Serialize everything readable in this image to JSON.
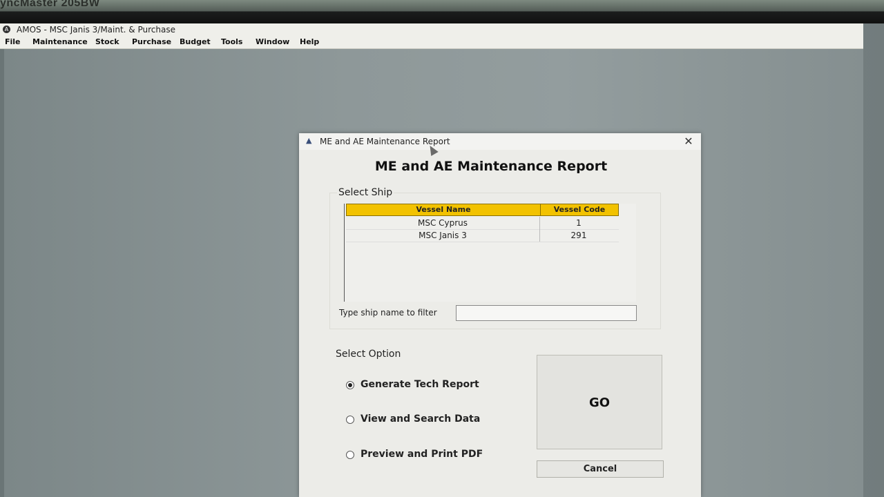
{
  "monitor": {
    "label": "yncMaster 205BW"
  },
  "app": {
    "title": "AMOS - MSC Janis 3/Maint. & Purchase",
    "icon": "amos-app-icon"
  },
  "menubar": {
    "items": [
      {
        "label": "File"
      },
      {
        "label": "Maintenance"
      },
      {
        "label": "Stock"
      },
      {
        "label": "Purchase"
      },
      {
        "label": "Budget"
      },
      {
        "label": "Tools"
      },
      {
        "label": "Window"
      },
      {
        "label": "Help"
      }
    ]
  },
  "dialog": {
    "title": "ME and AE Maintenance Report",
    "close_icon": "close-icon",
    "heading": "ME and AE Maintenance Report",
    "ship_section": {
      "label": "Select Ship",
      "columns": [
        "Vessel Name",
        "Vessel Code"
      ],
      "rows": [
        {
          "name": "MSC Cyprus",
          "code": "1"
        },
        {
          "name": "MSC Janis 3",
          "code": "291"
        }
      ],
      "filter_label": "Type ship name to filter",
      "filter_value": ""
    },
    "option_section": {
      "label": "Select Option",
      "options": [
        {
          "label": "Generate Tech Report",
          "selected": true
        },
        {
          "label": "View and Search Data",
          "selected": false
        },
        {
          "label": "Preview and Print PDF",
          "selected": false
        }
      ]
    },
    "go_label": "GO",
    "cancel_label": "Cancel"
  },
  "colors": {
    "grid_header": "#f2c200",
    "dialog_bg": "#ecece8"
  }
}
